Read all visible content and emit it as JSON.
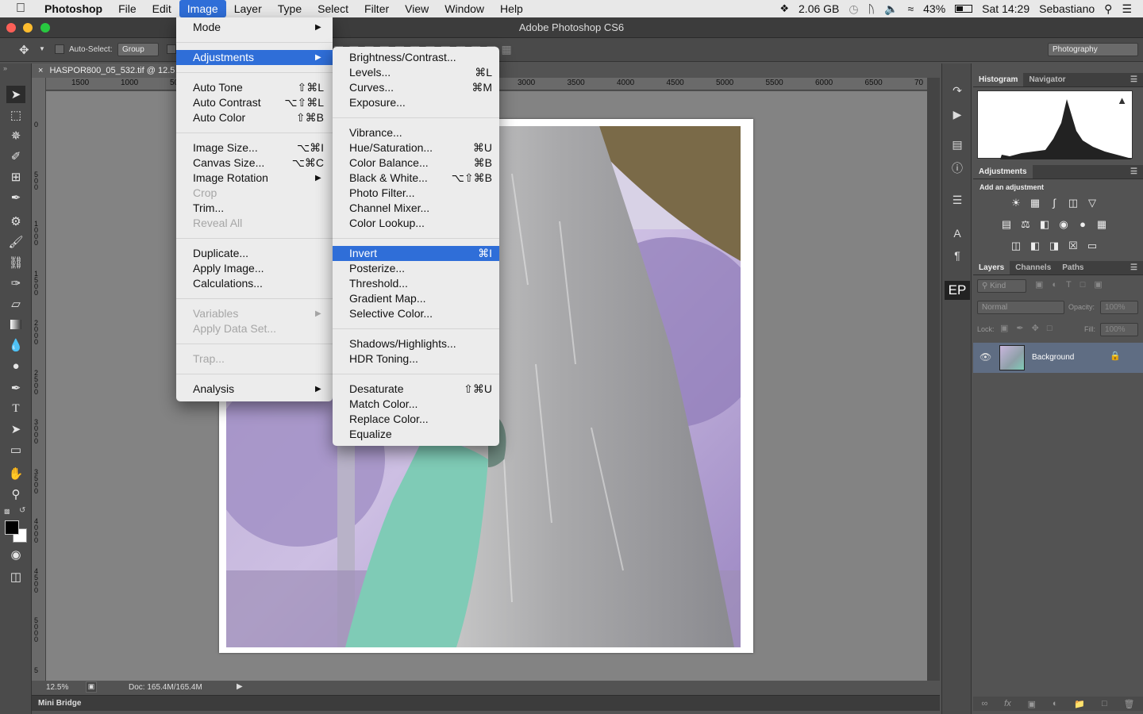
{
  "menubar": {
    "apple": "",
    "items": [
      "Photoshop",
      "File",
      "Edit",
      "Image",
      "Layer",
      "Type",
      "Select",
      "Filter",
      "View",
      "Window",
      "Help"
    ],
    "active_index": 3,
    "status": {
      "dropbox_storage": "2.06 GB",
      "battery": "43%",
      "datetime": "Sat 14:29",
      "user": "Sebastiano"
    }
  },
  "window": {
    "title": "Adobe Photoshop CS6"
  },
  "options": {
    "auto_select_label": "Auto-Select:",
    "auto_select_value": "Group",
    "workspace": "Photography"
  },
  "document": {
    "tab_title": "HASPOR800_05_532.tif @ 12.5",
    "zoom": "12.5%",
    "doc_size": "Doc: 165.4M/165.4M"
  },
  "ruler": {
    "h_left": [
      "1500",
      "1000",
      "50"
    ],
    "h_right": [
      "3000",
      "3500",
      "4000",
      "4500",
      "5000",
      "5500",
      "6000",
      "6500",
      "70"
    ],
    "v": [
      {
        "d": "0"
      },
      {
        "d": "5 0 0"
      },
      {
        "d": "1 0 0 0"
      },
      {
        "d": "1 5 0 0"
      },
      {
        "d": "2 0 0 0"
      },
      {
        "d": "2 5 0 0"
      },
      {
        "d": "3 0 0 0"
      },
      {
        "d": "3 5 0 0"
      },
      {
        "d": "4 0 0 0"
      },
      {
        "d": "4 5 0 0"
      },
      {
        "d": "5 0 0 0"
      },
      {
        "d": "5"
      }
    ]
  },
  "minibridge": "Mini Bridge",
  "image_menu": {
    "items": [
      {
        "label": "Mode",
        "submenu": true
      },
      {
        "sep": true
      },
      {
        "label": "Adjustments",
        "submenu": true,
        "highlight": true
      },
      {
        "sep": true
      },
      {
        "label": "Auto Tone",
        "shortcut": "⇧⌘L"
      },
      {
        "label": "Auto Contrast",
        "shortcut": "⌥⇧⌘L"
      },
      {
        "label": "Auto Color",
        "shortcut": "⇧⌘B"
      },
      {
        "sep": true
      },
      {
        "label": "Image Size...",
        "shortcut": "⌥⌘I"
      },
      {
        "label": "Canvas Size...",
        "shortcut": "⌥⌘C"
      },
      {
        "label": "Image Rotation",
        "submenu": true
      },
      {
        "label": "Crop",
        "disabled": true
      },
      {
        "label": "Trim..."
      },
      {
        "label": "Reveal All",
        "disabled": true
      },
      {
        "sep": true
      },
      {
        "label": "Duplicate..."
      },
      {
        "label": "Apply Image..."
      },
      {
        "label": "Calculations..."
      },
      {
        "sep": true
      },
      {
        "label": "Variables",
        "submenu": true,
        "disabled": true
      },
      {
        "label": "Apply Data Set...",
        "disabled": true
      },
      {
        "sep": true
      },
      {
        "label": "Trap...",
        "disabled": true
      },
      {
        "sep": true
      },
      {
        "label": "Analysis",
        "submenu": true
      }
    ]
  },
  "adjust_menu": {
    "items": [
      {
        "label": "Brightness/Contrast..."
      },
      {
        "label": "Levels...",
        "shortcut": "⌘L"
      },
      {
        "label": "Curves...",
        "shortcut": "⌘M"
      },
      {
        "label": "Exposure..."
      },
      {
        "sep": true
      },
      {
        "label": "Vibrance..."
      },
      {
        "label": "Hue/Saturation...",
        "shortcut": "⌘U"
      },
      {
        "label": "Color Balance...",
        "shortcut": "⌘B"
      },
      {
        "label": "Black & White...",
        "shortcut": "⌥⇧⌘B"
      },
      {
        "label": "Photo Filter..."
      },
      {
        "label": "Channel Mixer..."
      },
      {
        "label": "Color Lookup..."
      },
      {
        "sep": true
      },
      {
        "label": "Invert",
        "shortcut": "⌘I",
        "highlight": true
      },
      {
        "label": "Posterize..."
      },
      {
        "label": "Threshold..."
      },
      {
        "label": "Gradient Map..."
      },
      {
        "label": "Selective Color..."
      },
      {
        "sep": true
      },
      {
        "label": "Shadows/Highlights..."
      },
      {
        "label": "HDR Toning..."
      },
      {
        "sep": true
      },
      {
        "label": "Desaturate",
        "shortcut": "⇧⌘U"
      },
      {
        "label": "Match Color..."
      },
      {
        "label": "Replace Color..."
      },
      {
        "label": "Equalize"
      }
    ]
  },
  "panels": {
    "histogram_tabs": [
      "Histogram",
      "Navigator"
    ],
    "adjustments_tab": "Adjustments",
    "adjustments_hint": "Add an adjustment",
    "layers_tabs": [
      "Layers",
      "Channels",
      "Paths"
    ],
    "kind_label": "Kind",
    "blend_mode": "Normal",
    "opacity_label": "Opacity:",
    "opacity_value": "100%",
    "lock_label": "Lock:",
    "fill_label": "Fill:",
    "fill_value": "100%",
    "layer_name": "Background",
    "ep_label": "EP"
  }
}
